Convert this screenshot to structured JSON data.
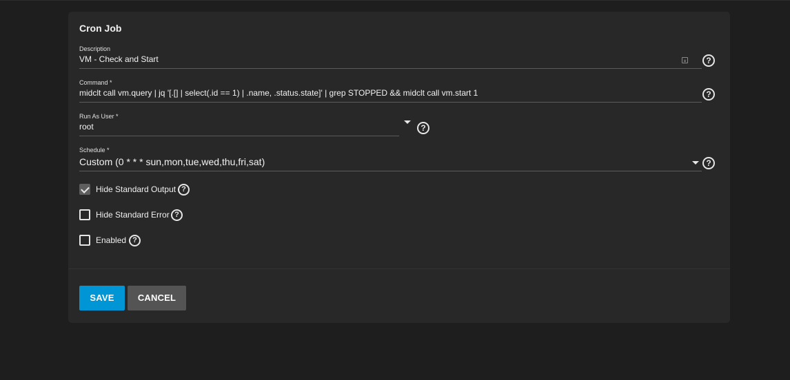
{
  "form": {
    "title": "Cron Job",
    "description": {
      "label": "Description",
      "value": "VM - Check and Start",
      "help": "?"
    },
    "command": {
      "label": "Command *",
      "value": "midclt call vm.query | jq '[.[] | select(.id == 1) | .name, .status.state]' | grep STOPPED && midclt call vm.start 1",
      "help": "?"
    },
    "run_as_user": {
      "label": "Run As User *",
      "value": "root",
      "help": "?"
    },
    "schedule": {
      "label": "Schedule *",
      "value": "Custom (0 * * * sun,mon,tue,wed,thu,fri,sat)",
      "help": "?"
    },
    "checkboxes": [
      {
        "label": "Hide Standard Output",
        "checked": true,
        "help": "?"
      },
      {
        "label": "Hide Standard Error",
        "checked": false,
        "help": "?"
      },
      {
        "label": "Enabled",
        "checked": false,
        "help": "?"
      }
    ]
  },
  "buttons": {
    "save": "SAVE",
    "cancel": "CANCEL"
  },
  "colors": {
    "page_bg": "#1e1e1e",
    "card_bg": "#282828",
    "primary": "#0095d5",
    "secondary": "#545454"
  }
}
